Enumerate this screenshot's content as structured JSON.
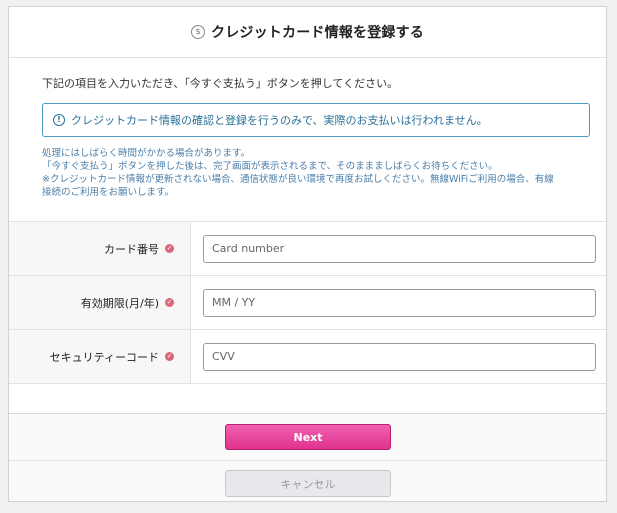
{
  "header": {
    "icon": "yen-circle-icon",
    "title": "クレジットカード情報を登録する"
  },
  "instructions": "下記の項目を入力いただき、「今すぐ支払う」ボタンを押してください。",
  "notice": {
    "icon": "info-circle-icon",
    "text": "クレジットカード情報の確認と登録を行うのみで、実際のお支払いは行われません。"
  },
  "notes": [
    "処理にはしばらく時間がかかる場合があります。",
    "「今すぐ支払う」ボタンを押した後は、完了画面が表示されるまで、そのままましばらくお待ちください。",
    "※クレジットカード情報が更新されない場合、通信状態が良い環境で再度お試しください。無線WiFiご利用の場合、有線",
    "接続のご利用をお願いします。"
  ],
  "form": {
    "card_number": {
      "label": "カード番号",
      "placeholder": "Card number"
    },
    "expiry": {
      "label": "有効期限(月/年)",
      "placeholder": "MM / YY"
    },
    "cvv": {
      "label": "セキュリティーコード",
      "placeholder": "CVV"
    }
  },
  "buttons": {
    "next": "Next",
    "cancel": "キャンセル"
  },
  "colors": {
    "accent": "#e0338f",
    "notice_border": "#4a9bc4",
    "required": "#d9667a"
  }
}
